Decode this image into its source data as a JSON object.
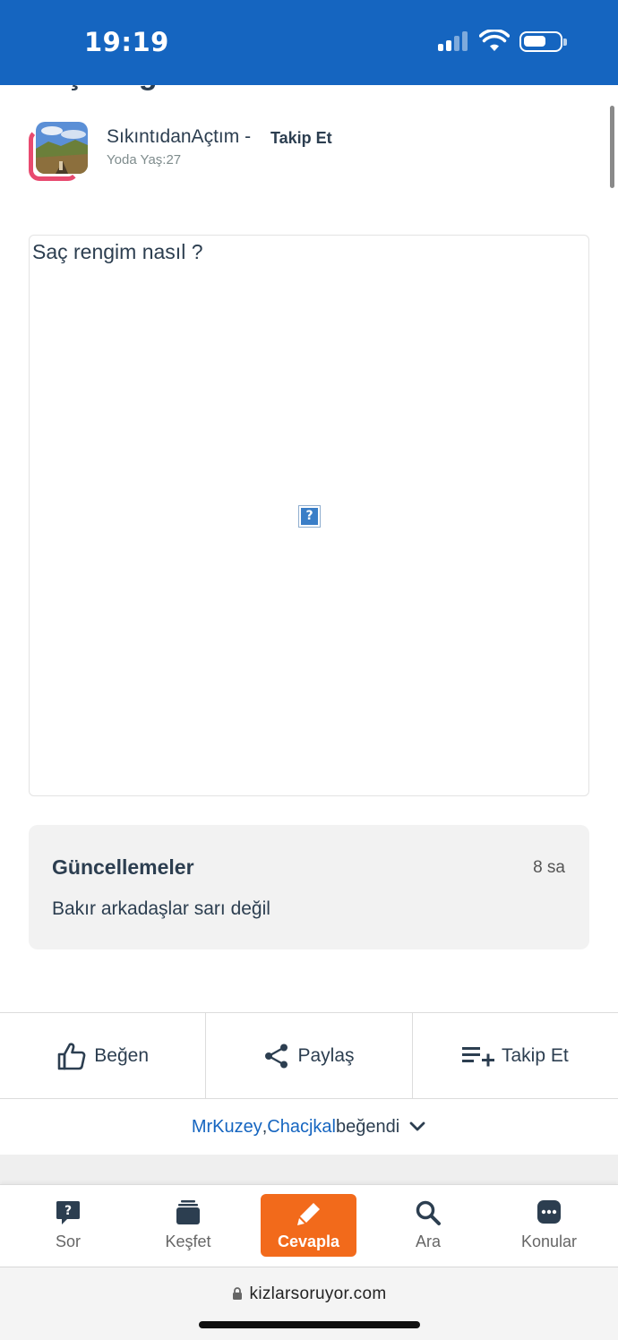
{
  "status_bar": {
    "time": "19:19"
  },
  "question": {
    "title_cut": "Saç rengim nasıl ?"
  },
  "author": {
    "name": "SıkıntıdanAçtım",
    "separator": "-",
    "follow_label": "Takip Et",
    "meta": "Yoda Yaş:27"
  },
  "post": {
    "text": "Saç rengim nasıl ?",
    "broken_image_glyph": "?"
  },
  "updates": {
    "title": "Güncellemeler",
    "time": "8 sa",
    "text": "Bakır arkadaşlar sarı değil"
  },
  "actions": {
    "like": "Beğen",
    "share": "Paylaş",
    "follow": "Takip Et"
  },
  "likes": {
    "user1": "MrKuzey",
    "comma": ", ",
    "user2": "Chacjkal",
    "suffix": " beğendi"
  },
  "bottom_nav": {
    "ask": "Sor",
    "explore": "Keşfet",
    "answer": "Cevapla",
    "search": "Ara",
    "topics": "Konular"
  },
  "browser": {
    "url": "kizlarsoruyor.com"
  },
  "colors": {
    "header_blue": "#1565c0",
    "accent_orange": "#f26a1b",
    "link_blue": "#1565c0",
    "text_dark": "#2c3e50",
    "avatar_ring": "#e84a6f"
  }
}
